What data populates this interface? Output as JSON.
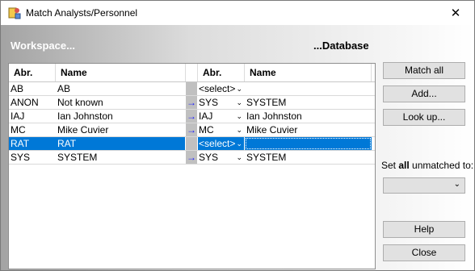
{
  "window": {
    "title": "Match Analysts/Personnel",
    "close_glyph": "✕"
  },
  "headers": {
    "workspace": "Workspace...",
    "database": "...Database"
  },
  "columns": {
    "abr": "Abr.",
    "name": "Name",
    "db_abr": "Abr.",
    "db_name": "Name"
  },
  "rows": [
    {
      "abr": "AB",
      "name": "AB",
      "arrow": "",
      "db_abr": "<select>",
      "db_name": "",
      "selected": false
    },
    {
      "abr": "ANON",
      "name": "Not known",
      "arrow": "→",
      "db_abr": "SYS",
      "db_name": "SYSTEM",
      "selected": false
    },
    {
      "abr": "IAJ",
      "name": "Ian Johnston",
      "arrow": "→",
      "db_abr": "IAJ",
      "db_name": "Ian Johnston",
      "selected": false
    },
    {
      "abr": "MC",
      "name": "Mike Cuvier",
      "arrow": "→",
      "db_abr": "MC",
      "db_name": "Mike Cuvier",
      "selected": false
    },
    {
      "abr": "RAT",
      "name": "RAT",
      "arrow": "",
      "db_abr": "<select>",
      "db_name": "",
      "selected": true
    },
    {
      "abr": "SYS",
      "name": "SYSTEM",
      "arrow": "→",
      "db_abr": "SYS",
      "db_name": "SYSTEM",
      "selected": false
    }
  ],
  "buttons": {
    "match_all": "Match all",
    "add": "Add...",
    "lookup": "Look up...",
    "help": "Help",
    "close": "Close"
  },
  "set_unmatched": {
    "prefix": "Set ",
    "bold": "all",
    "suffix": " unmatched to:",
    "value": ""
  },
  "icons": {
    "app": "analyst-match-icon",
    "dropdown": "chevron-down-icon",
    "arrow": "right-arrow-icon"
  },
  "colors": {
    "selection": "#0078d7",
    "arrow": "#1a1aff"
  }
}
